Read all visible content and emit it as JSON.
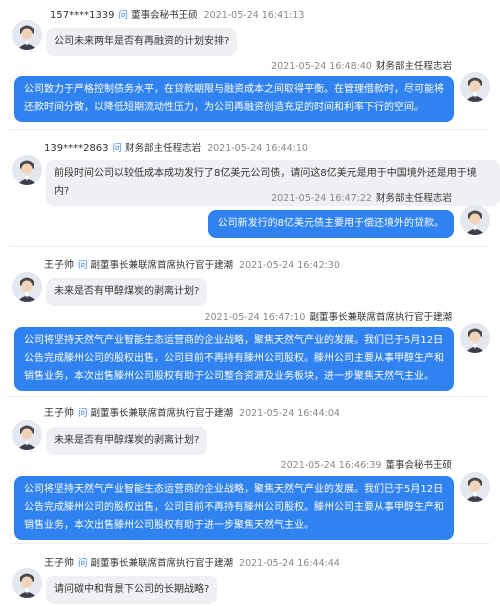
{
  "threads": [
    {
      "q_user": "157****1339",
      "q_tag": "问",
      "q_role": "董事会秘书王硕",
      "q_time": "2021-05-24 16:41:13",
      "q_text": "公司未来两年是否有再融资的计划安排?",
      "a_time": "2021-05-24 16:48:40",
      "a_role": "财务部主任程志岩",
      "a_text": "公司致力于严格控制债务水平，在贷款期限与融资成本之间取得平衡。在管理借款时，尽可能将还款时间分散，以降低短期流动性压力，为公司再融资创造充足的时间和利率下行的空间。"
    },
    {
      "q_user": "139****2863",
      "q_tag": "问",
      "q_role": "财务部主任程志岩",
      "q_time": "2021-05-24 16:44:10",
      "q_text": "前段时间公司以较低成本成功发行了8亿美元公司债，请问这8亿美元是用于中国境外还是用于境内?",
      "a_time": "2021-05-24 16:47:22",
      "a_role": "财务部主任程志岩",
      "a_text": "公司新发行的8亿美元债主要用于偿还境外的贷款。"
    },
    {
      "q_user": "王子帅",
      "q_tag": "问",
      "q_role": "副董事长兼联席首席执行官于建潮",
      "q_time": "2021-05-24 16:42:30",
      "q_text": "未来是否有甲醇煤炭的剥离计划?",
      "a_time": "2021-05-24 16:47:10",
      "a_role": "副董事长兼联席首席执行官于建潮",
      "a_text": "公司将坚持天然气产业智能生态运营商的企业战略，聚焦天然气产业的发展。我们已于5月12日公告完成滕州公司的股权出售，公司目前不再持有滕州公司股权。滕州公司主要从事甲醇生产和销售业务，本次出售滕州公司股权有助于公司整合资源及业务板块，进一步聚焦天然气主业。"
    },
    {
      "q_user": "王子帅",
      "q_tag": "问",
      "q_role": "副董事长兼联席首席执行官于建潮",
      "q_time": "2021-05-24 16:44:04",
      "q_text": "未来是否有甲醇煤炭的剥离计划?",
      "a_time": "2021-05-24 16:46:39",
      "a_role": "董事会秘书王硕",
      "a_text": "公司将坚持天然气产业智能生态运营商的企业战略，聚焦天然气产业的发展。我们已于5月12日公告完成滕州公司的股权出售，公司目前不再持有滕州公司股权。滕州公司主要从事甲醇生产和销售业务，本次出售滕州公司股权有助于进一步聚焦天然气主业。"
    },
    {
      "q_user": "王子帅",
      "q_tag": "问",
      "q_role": "副董事长兼联席首席执行官于建潮",
      "q_time": "2021-05-24 16:44:44",
      "q_text": "请问碳中和背景下公司的长期战略?"
    }
  ]
}
